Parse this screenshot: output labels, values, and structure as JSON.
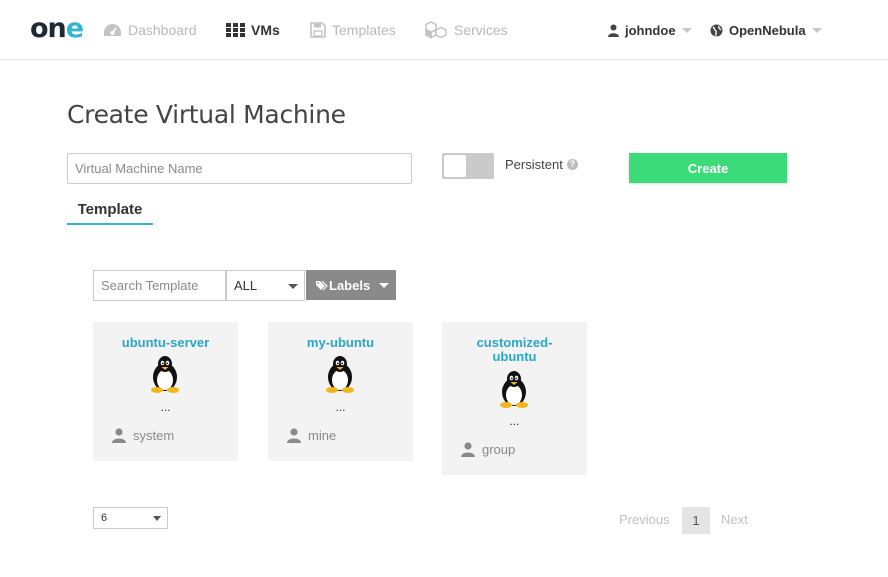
{
  "brand": {
    "logo_text_a": "on",
    "logo_text_b": "e"
  },
  "nav": {
    "dashboard": "Dashboard",
    "vms": "VMs",
    "templates": "Templates",
    "services": "Services",
    "user": "johndoe",
    "zone": "OpenNebula"
  },
  "page": {
    "title": "Create Virtual Machine",
    "name_placeholder": "Virtual Machine Name",
    "persistent_label": "Persistent",
    "persistent_on": false,
    "create_label": "Create",
    "tab_template": "Template"
  },
  "filters": {
    "search_placeholder": "Search Template",
    "scope_value": "ALL",
    "labels_button": "Labels"
  },
  "templates": [
    {
      "name": "ubuntu-server",
      "description": "...",
      "owner": "system",
      "os_icon": "linux-tux-icon"
    },
    {
      "name": "my-ubuntu",
      "description": "...",
      "owner": "mine",
      "os_icon": "linux-tux-icon"
    },
    {
      "name": "customized-ubuntu",
      "description": "...",
      "owner": "group",
      "os_icon": "linux-tux-icon"
    }
  ],
  "pagination": {
    "page_size": "6",
    "previous": "Previous",
    "current": "1",
    "next": "Next"
  },
  "colors": {
    "accent": "#35b5d3",
    "create_button": "#3bdb7a",
    "template_name": "#2aa6c9",
    "labels_button": "#8a8a8a"
  }
}
